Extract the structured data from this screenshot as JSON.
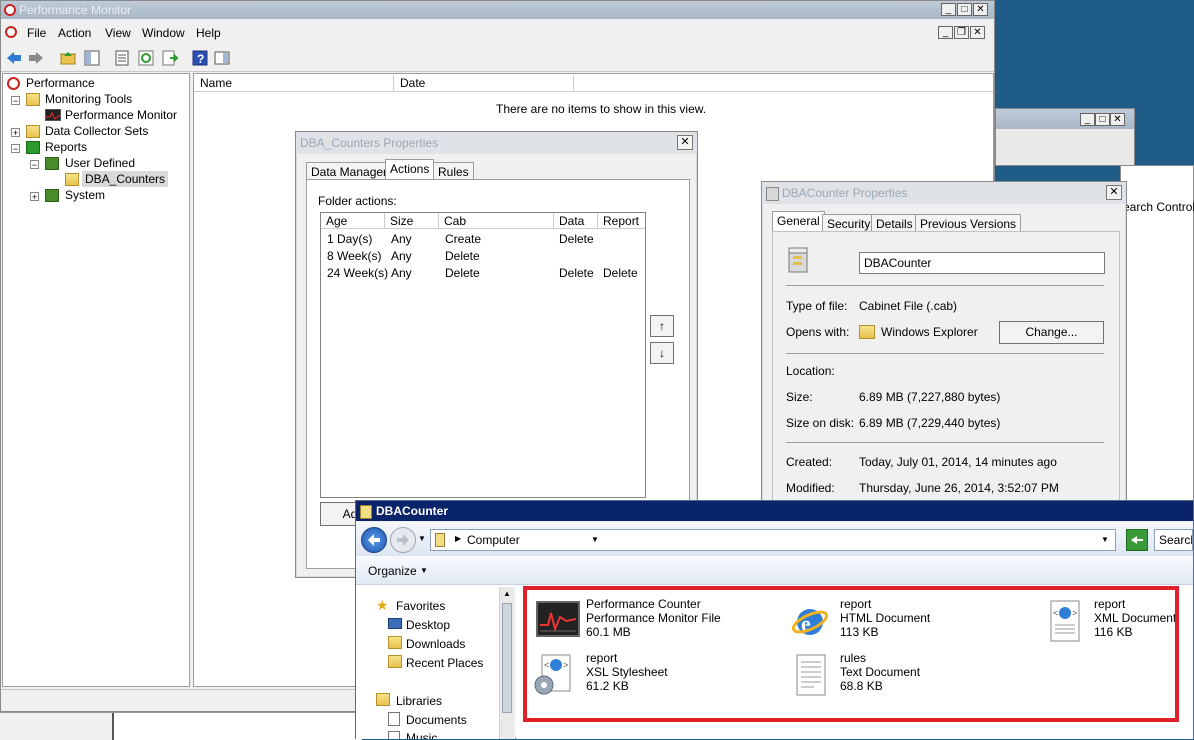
{
  "perfmon": {
    "title": "Performance Monitor",
    "menu": [
      "File",
      "Action",
      "View",
      "Window",
      "Help"
    ],
    "tree": {
      "root": "Performance",
      "monitoring_tools": "Monitoring Tools",
      "performance_monitor": "Performance Monitor",
      "data_collector_sets": "Data Collector Sets",
      "reports": "Reports",
      "user_defined": "User Defined",
      "dba_counters": "DBA_Counters",
      "system": "System"
    },
    "list": {
      "columns": [
        "Name",
        "Date"
      ],
      "empty_text": "There are no items to show in this view."
    }
  },
  "dba_props": {
    "title": "DBA_Counters Properties",
    "tabs": [
      "Data Manager",
      "Actions",
      "Rules"
    ],
    "folder_actions_label": "Folder actions:",
    "columns": [
      "Age",
      "Size",
      "Cab",
      "Data",
      "Report"
    ],
    "rows": [
      {
        "age": "1 Day(s)",
        "size": "Any",
        "cab": "Create",
        "data": "Delete",
        "report": ""
      },
      {
        "age": "8 Week(s)",
        "size": "Any",
        "cab": "Delete",
        "data": "",
        "report": ""
      },
      {
        "age": "24 Week(s)",
        "size": "Any",
        "cab": "Delete",
        "data": "Delete",
        "report": "Delete"
      }
    ],
    "add_button": "Ad",
    "move_up": "↑",
    "move_down": "↓"
  },
  "file_props": {
    "title": "DBACounter Properties",
    "tabs": [
      "General",
      "Security",
      "Details",
      "Previous Versions"
    ],
    "name_value": "DBACounter",
    "type_label": "Type of file:",
    "type_value": "Cabinet File (.cab)",
    "opens_label": "Opens with:",
    "opens_value": "Windows Explorer",
    "change_button": "Change...",
    "location_label": "Location:",
    "size_label": "Size:",
    "size_value": "6.89 MB (7,227,880 bytes)",
    "disk_label": "Size on disk:",
    "disk_value": "6.89 MB (7,229,440 bytes)",
    "created_label": "Created:",
    "created_value": "Today, July 01, 2014, 14 minutes ago",
    "modified_label": "Modified:",
    "modified_value": "Thursday, June 26, 2014, 3:52:07 PM"
  },
  "bg_window": {
    "partial_text": "earch Control P"
  },
  "explorer": {
    "title": "DBACounter",
    "address": "Computer",
    "search_placeholder": "Search",
    "organize": "Organize",
    "nav": {
      "favorites": "Favorites",
      "desktop": "Desktop",
      "downloads": "Downloads",
      "recent": "Recent Places",
      "libraries": "Libraries",
      "documents": "Documents",
      "music": "Music"
    },
    "files": [
      {
        "name": "Performance Counter",
        "type": "Performance Monitor File",
        "size": "60.1 MB"
      },
      {
        "name": "report",
        "type": "HTML Document",
        "size": "113 KB"
      },
      {
        "name": "report",
        "type": "XML Document",
        "size": "116 KB"
      },
      {
        "name": "report",
        "type": "XSL Stylesheet",
        "size": "61.2 KB"
      },
      {
        "name": "rules",
        "type": "Text Document",
        "size": "68.8 KB"
      }
    ]
  },
  "colors": {
    "desktop": "#1f5c87",
    "highlight": "#e0202a",
    "active_title": "#0a246a"
  }
}
